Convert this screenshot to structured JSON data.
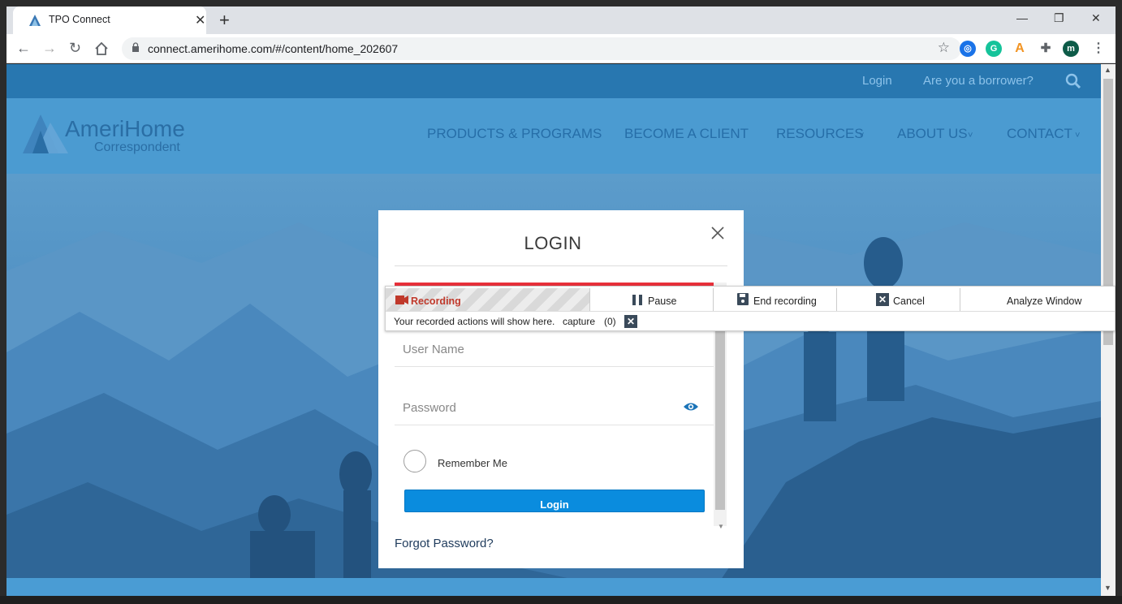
{
  "browser": {
    "tab_title": "TPO Connect",
    "url": "connect.amerihome.com/#/content/home_202607",
    "profile_initial": "m"
  },
  "site": {
    "topbar": {
      "login": "Login",
      "borrower": "Are you a borrower?"
    },
    "logo": {
      "main": "AmeriHome",
      "sub": "Correspondent"
    },
    "nav": [
      "PRODUCTS & PROGRAMS",
      "BECOME A CLIENT",
      "RESOURCES",
      "ABOUT US",
      "CONTACT"
    ],
    "nav_dropdown_marker": "˅"
  },
  "modal": {
    "title": "LOGIN",
    "username_placeholder": "User Name",
    "password_placeholder": "Password",
    "remember_label": "Remember Me",
    "login_button": "Login",
    "forgot_link": "Forgot Password?"
  },
  "recorder": {
    "status_label": "Recording",
    "pause_label": "Pause",
    "end_label": "End recording",
    "cancel_label": "Cancel",
    "analyze_label": "Analyze Window",
    "actions_text": "Your recorded actions will show here.",
    "capture_label": "capture",
    "capture_count": "(0)"
  },
  "colors": {
    "accent_red": "#e8303a",
    "button_blue": "#0a8cde",
    "header_blue": "#4b9bd1"
  }
}
